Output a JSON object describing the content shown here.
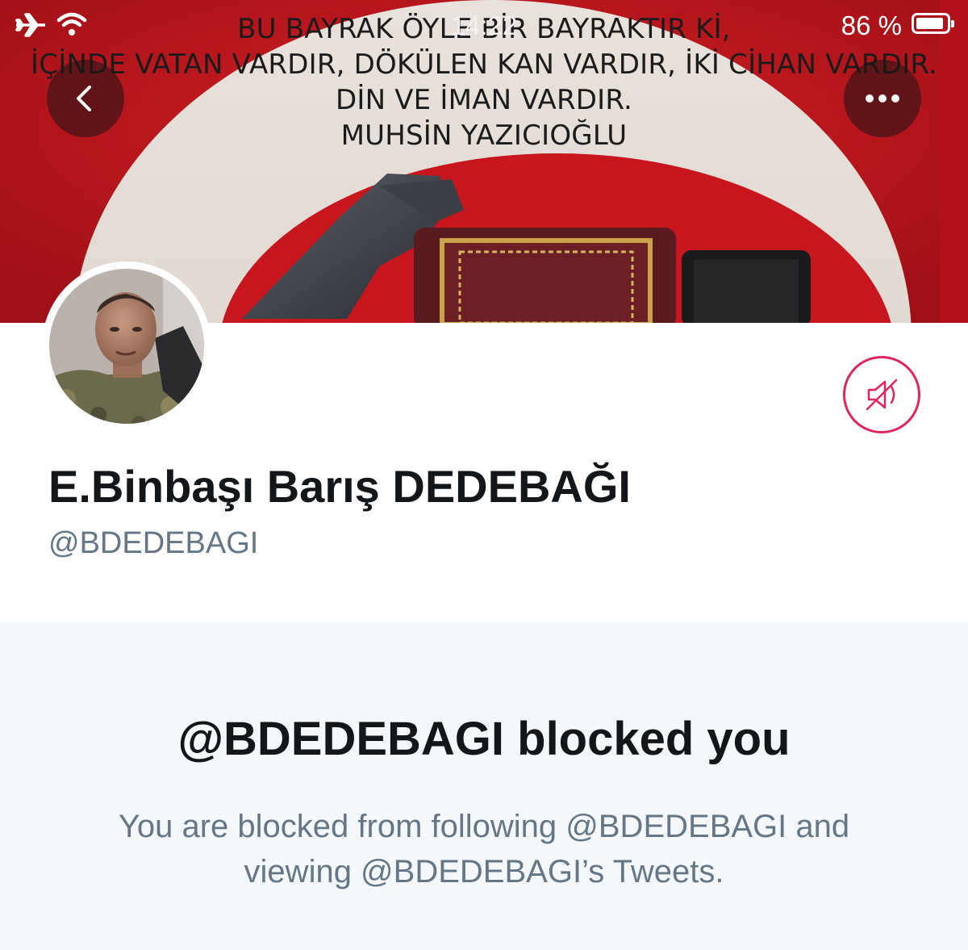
{
  "status_bar": {
    "time": "14:22",
    "battery_percent": "86 %",
    "airplane_icon": "airplane-icon",
    "wifi_icon": "wifi-icon",
    "battery_icon": "battery-icon"
  },
  "banner": {
    "lines": [
      "BU BAYRAK ÖYLE BİR BAYRAKTIR Kİ,",
      "İÇİNDE VATAN VARDIR, DÖKÜLEN KAN VARDIR, İKİ CİHAN VARDIR.",
      "DİN VE İMAN VARDIR.",
      "MUHSİN YAZICIOĞLU"
    ],
    "back_icon": "chevron-left-icon",
    "more_icon": "more-horizontal-icon"
  },
  "profile": {
    "display_name": "E.Binbaşı Barış DEDEBAĞI",
    "handle": "@BDEDEBAGI",
    "mute_icon": "muted-speaker-icon"
  },
  "blocked": {
    "title": "@BDEDEBAGI blocked you",
    "message": "You are blocked from following @BDEDEBAGI and viewing @BDEDEBAGI’s Tweets."
  },
  "colors": {
    "accent": "#e0245e",
    "text_primary": "#14171a",
    "text_secondary": "#657786",
    "panel_bg": "#f5f8fa",
    "flag_red": "#c9141c"
  }
}
